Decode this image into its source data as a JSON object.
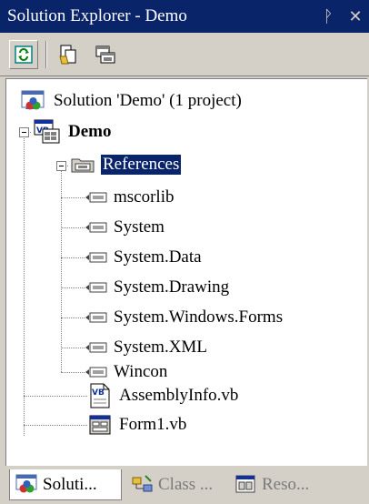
{
  "window": {
    "title": "Solution Explorer - Demo",
    "pin_glyph": "ᚹ",
    "close_glyph": "✕"
  },
  "toolbar": {
    "buttons": [
      {
        "name": "refresh",
        "icon": "refresh-icon"
      },
      {
        "name": "show-all-files",
        "icon": "show-all-files-icon"
      },
      {
        "name": "properties",
        "icon": "properties-icon"
      }
    ]
  },
  "tree": {
    "solution": "Solution 'Demo' (1 project)",
    "project": "Demo",
    "references_folder": "References",
    "references": [
      "mscorlib",
      "System",
      "System.Data",
      "System.Drawing",
      "System.Windows.Forms",
      "System.XML",
      "Wincon"
    ],
    "files": [
      "AssemblyInfo.vb",
      "Form1.vb"
    ]
  },
  "tabs": [
    {
      "label": "Soluti...",
      "icon": "solution-icon",
      "active": true
    },
    {
      "label": "Class ...",
      "icon": "class-view-icon",
      "active": false
    },
    {
      "label": "Reso...",
      "icon": "resource-view-icon",
      "active": false
    }
  ],
  "colors": {
    "titlebar": "#0a246a",
    "selection": "#0a246a",
    "chrome": "#d4d0c8"
  }
}
